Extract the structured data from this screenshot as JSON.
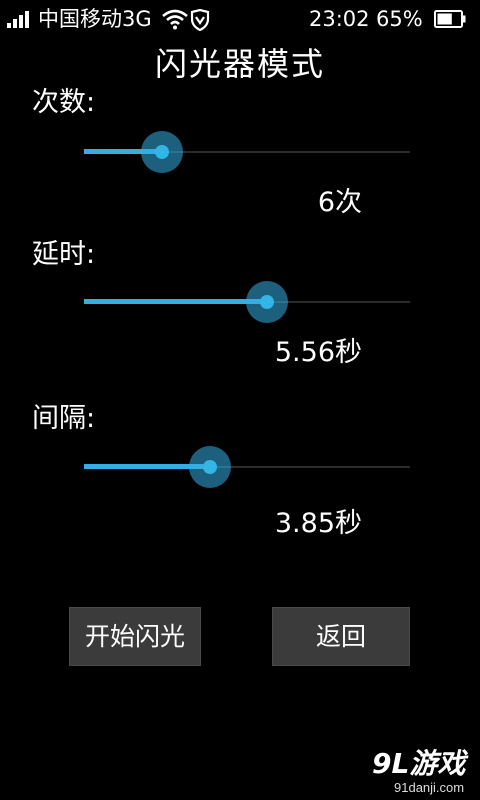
{
  "status_bar": {
    "carrier": "中国移动3G",
    "time": "23:02",
    "battery_percent": "65%",
    "battery_level": 0.65
  },
  "page": {
    "title": "闪光器模式"
  },
  "settings": {
    "count": {
      "label": "次数:",
      "value": "6次",
      "slider_fraction": 0.24
    },
    "delay": {
      "label": "延时:",
      "value": "5.56秒",
      "slider_fraction": 0.56
    },
    "interval": {
      "label": "间隔:",
      "value": "3.85秒",
      "slider_fraction": 0.385
    }
  },
  "buttons": {
    "start_label": "开始闪光",
    "back_label": "返回"
  },
  "watermark": {
    "logo": "9L游戏",
    "url": "91danji.com"
  },
  "colors": {
    "accent": "#33b5e5",
    "background": "#000000",
    "button": "#3b3b3b"
  }
}
